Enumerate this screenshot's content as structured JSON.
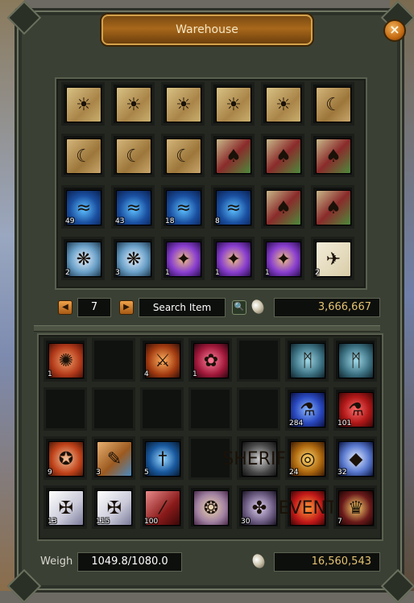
{
  "window": {
    "title": "Warehouse",
    "close_label": "×"
  },
  "warehouse": {
    "slots": [
      {
        "icon": "sun-scroll-icon",
        "cls": "ic-scroll-sun",
        "glyph": "☀",
        "count": ""
      },
      {
        "icon": "sun-scroll-icon",
        "cls": "ic-scroll-sun",
        "glyph": "☀",
        "count": ""
      },
      {
        "icon": "sun-scroll-icon",
        "cls": "ic-scroll-sun",
        "glyph": "☀",
        "count": ""
      },
      {
        "icon": "sun-scroll-icon",
        "cls": "ic-scroll-sun",
        "glyph": "☀",
        "count": ""
      },
      {
        "icon": "sun-scroll-icon",
        "cls": "ic-scroll-sun",
        "glyph": "☀",
        "count": ""
      },
      {
        "icon": "moon-scroll-icon",
        "cls": "ic-scroll-moon",
        "glyph": "☾",
        "count": ""
      },
      {
        "icon": "moon-scroll-icon",
        "cls": "ic-scroll-moon",
        "glyph": "☾",
        "count": ""
      },
      {
        "icon": "moon-scroll-icon",
        "cls": "ic-scroll-moon",
        "glyph": "☾",
        "count": ""
      },
      {
        "icon": "moon-scroll-icon",
        "cls": "ic-scroll-moon",
        "glyph": "☾",
        "count": ""
      },
      {
        "icon": "elf-box-icon",
        "cls": "ic-box-elf",
        "glyph": "♠",
        "count": ""
      },
      {
        "icon": "elf-box-icon",
        "cls": "ic-box-elf",
        "glyph": "♠",
        "count": ""
      },
      {
        "icon": "elf-box-icon",
        "cls": "ic-box-elf",
        "glyph": "♠",
        "count": ""
      },
      {
        "icon": "blue-swirl-icon",
        "cls": "ic-blue-swirl",
        "glyph": "≈",
        "count": "49"
      },
      {
        "icon": "blue-swirl-icon",
        "cls": "ic-blue-swirl",
        "glyph": "≈",
        "count": "43"
      },
      {
        "icon": "blue-swirl-icon",
        "cls": "ic-blue-swirl",
        "glyph": "≈",
        "count": "18"
      },
      {
        "icon": "blue-swirl-icon",
        "cls": "ic-blue-swirl",
        "glyph": "≈",
        "count": "8"
      },
      {
        "icon": "elf-box-icon",
        "cls": "ic-box-elf",
        "glyph": "♠",
        "count": ""
      },
      {
        "icon": "elf-box-icon",
        "cls": "ic-box-elf",
        "glyph": "♠",
        "count": ""
      },
      {
        "icon": "feather-orb-icon",
        "cls": "ic-feather",
        "glyph": "❋",
        "count": "2"
      },
      {
        "icon": "feather-orb-icon",
        "cls": "ic-feather",
        "glyph": "❋",
        "count": "3"
      },
      {
        "icon": "purple-disc-icon",
        "cls": "ic-purple-disc",
        "glyph": "✦",
        "count": "1"
      },
      {
        "icon": "purple-disc-icon",
        "cls": "ic-purple-disc",
        "glyph": "✦",
        "count": "1"
      },
      {
        "icon": "purple-disc-icon",
        "cls": "ic-purple-disc",
        "glyph": "✦",
        "count": "1"
      },
      {
        "icon": "red-bird-letter-icon",
        "cls": "ic-red-letter",
        "glyph": "✈",
        "count": "2"
      }
    ]
  },
  "controls": {
    "prev_label": "◀",
    "next_label": "▶",
    "page": "7",
    "search_label": "Search Item",
    "search_glyph": "🔍",
    "warehouse_gold": "3,666,667"
  },
  "inventory": {
    "slots": [
      {
        "icon": "red-scroll-icon",
        "cls": "ic-red-scroll",
        "glyph": "✺",
        "count": "1"
      },
      {
        "icon": "",
        "cls": "",
        "glyph": "",
        "count": ""
      },
      {
        "icon": "fire-sword-icon",
        "cls": "ic-fire-sword",
        "glyph": "⚔",
        "count": "4"
      },
      {
        "icon": "red-orb-icon",
        "cls": "ic-red-orb",
        "glyph": "✿",
        "count": "1"
      },
      {
        "icon": "",
        "cls": "",
        "glyph": "",
        "count": ""
      },
      {
        "icon": "rune-stone-icon",
        "cls": "ic-rune-stone",
        "glyph": "ᛗ",
        "count": ""
      },
      {
        "icon": "rune-stone-icon",
        "cls": "ic-rune-stone",
        "glyph": "ᛗ",
        "count": ""
      },
      {
        "icon": "",
        "cls": "",
        "glyph": "",
        "count": ""
      },
      {
        "icon": "",
        "cls": "",
        "glyph": "",
        "count": ""
      },
      {
        "icon": "",
        "cls": "",
        "glyph": "",
        "count": ""
      },
      {
        "icon": "",
        "cls": "",
        "glyph": "",
        "count": ""
      },
      {
        "icon": "",
        "cls": "",
        "glyph": "",
        "count": ""
      },
      {
        "icon": "blue-potion-icon",
        "cls": "ic-blue-potion",
        "glyph": "⚗",
        "count": "284"
      },
      {
        "icon": "red-potion-icon",
        "cls": "ic-red-potion",
        "glyph": "⚗",
        "count": "101"
      },
      {
        "icon": "red-map-icon",
        "cls": "ic-red-map",
        "glyph": "✪",
        "count": "9"
      },
      {
        "icon": "orange-scroll-icon",
        "cls": "ic-orange-scroll",
        "glyph": "✎",
        "count": "3"
      },
      {
        "icon": "blue-dagger-icon",
        "cls": "ic-blue-dagger",
        "glyph": "†",
        "count": "5"
      },
      {
        "icon": "",
        "cls": "",
        "glyph": "",
        "count": ""
      },
      {
        "icon": "sheriff-badge-icon",
        "cls": "ic-sheriff",
        "glyph": "SHERIFF",
        "count": ""
      },
      {
        "icon": "gold-ring-icon",
        "cls": "ic-gold-ring",
        "glyph": "◎",
        "count": "24"
      },
      {
        "icon": "crystal-icon",
        "cls": "ic-crystal",
        "glyph": "◆",
        "count": "32"
      },
      {
        "icon": "scroll-roll-icon",
        "cls": "ic-scroll-roll",
        "glyph": "✠",
        "count": "13"
      },
      {
        "icon": "scroll-roll-icon",
        "cls": "ic-scroll-roll",
        "glyph": "✠",
        "count": "115"
      },
      {
        "icon": "red-tube-icon",
        "cls": "ic-red-tube",
        "glyph": "⁄",
        "count": "100"
      },
      {
        "icon": "purple-map-icon",
        "cls": "ic-map-purple",
        "glyph": "❂",
        "count": ""
      },
      {
        "icon": "grey-orb-icon",
        "cls": "ic-grey-orb",
        "glyph": "✤",
        "count": "30"
      },
      {
        "icon": "event-box-icon",
        "cls": "ic-event",
        "glyph": "EVENT",
        "count": ""
      },
      {
        "icon": "royal-crest-icon",
        "cls": "ic-crest",
        "glyph": "♛",
        "count": "7"
      }
    ]
  },
  "footer": {
    "weigh_label": "Weigh",
    "weigh_value": "1049.8/1080.0",
    "inventory_gold": "16,560,543"
  }
}
